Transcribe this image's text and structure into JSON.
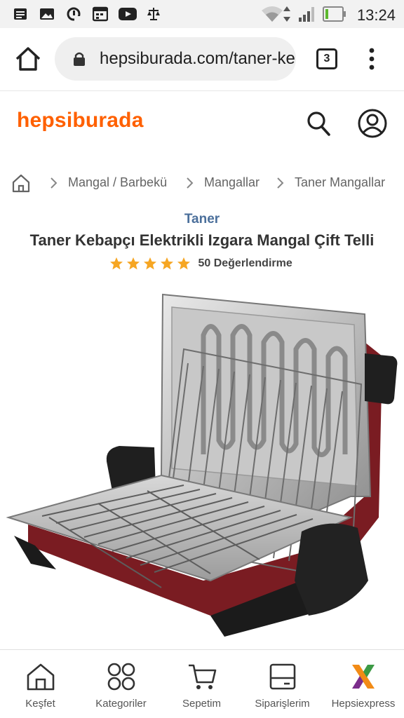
{
  "status_bar": {
    "time": "13:24",
    "icons": [
      "news-icon",
      "gallery-icon",
      "sync-icon",
      "calendar-icon",
      "youtube-icon",
      "scales-icon",
      "wifi-icon",
      "signal-icon",
      "battery-icon"
    ]
  },
  "browser": {
    "url": "hepsiburada.com/taner-kebapci",
    "tab_count": "3",
    "icons": [
      "home-icon",
      "lock-icon",
      "menu-dots-icon"
    ]
  },
  "header": {
    "logo": "hepsiburada",
    "logo_color": "#ff6000",
    "icons": [
      "search-icon",
      "account-icon"
    ]
  },
  "breadcrumb": {
    "items": [
      "Mangal / Barbekü",
      "Mangallar",
      "Taner Mangallar"
    ]
  },
  "product": {
    "brand": "Taner",
    "title": "Taner Kebapçı Elektrikli Izgara Mangal Çift Telli",
    "rating": 5,
    "rating_max": 5,
    "reviews_label": "50 Değerlendirme",
    "star_color": "#f6a623"
  },
  "bottom_nav": {
    "items": [
      {
        "label": "Keşfet",
        "icon": "home-icon"
      },
      {
        "label": "Kategoriler",
        "icon": "grid-icon"
      },
      {
        "label": "Sepetim",
        "icon": "cart-icon"
      },
      {
        "label": "Siparişlerim",
        "icon": "box-icon"
      },
      {
        "label": "Hepsiexpress",
        "icon": "express-x-icon"
      }
    ]
  }
}
